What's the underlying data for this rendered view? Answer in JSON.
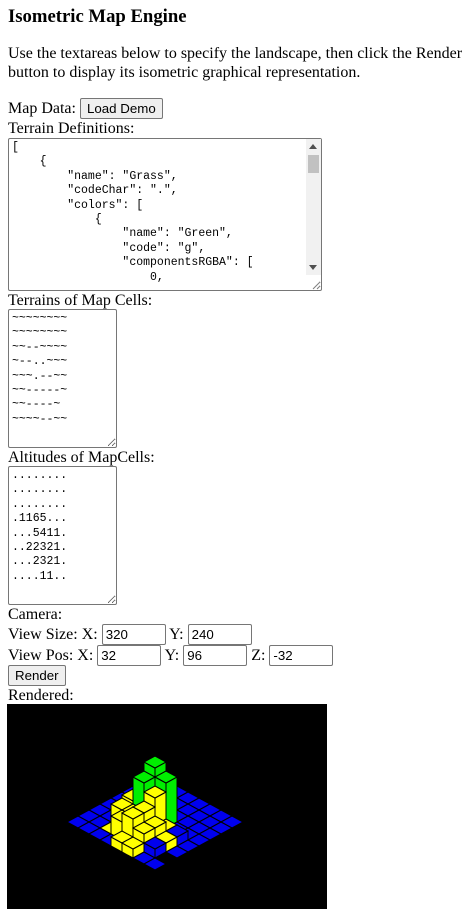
{
  "page": {
    "title": "Isometric Map Engine",
    "intro": "Use the textareas below to specify the landscape, then click the Render button to display its isometric graphical representation."
  },
  "map_data": {
    "label": "Map Data:",
    "load_demo_label": "Load Demo"
  },
  "terrain_definitions": {
    "label": "Terrain Definitions:",
    "value": "[\n    {\n        \"name\": \"Grass\",\n        \"codeChar\": \".\",\n        \"colors\": [\n            {\n                \"name\": \"Green\",\n                \"code\": \"g\",\n                \"componentsRGBA\": [\n                    0,"
  },
  "terrains_of_map_cells": {
    "label": "Terrains of Map Cells:",
    "value": "~~~~~~~~\n~~~~~~~~\n~~--~~~~\n~--..~~~\n~~~.--~~\n~~-----~\n~~----~\n~~~~--~~"
  },
  "altitudes_of_map_cells": {
    "label": "Altitudes of MapCells:",
    "value": "........\n........\n........\n.1165...\n...5411.\n..22321.\n...2321.\n....11.."
  },
  "camera": {
    "label": "Camera:",
    "view_size_label": "View Size: X:",
    "view_size_x": "320",
    "view_size_y_label": "Y:",
    "view_size_y": "240",
    "view_pos_label": "View Pos: X:",
    "view_pos_x": "32",
    "view_pos_y_label": "Y:",
    "view_pos_y": "96",
    "view_pos_z_label": "Z:",
    "view_pos_z": "-32"
  },
  "render": {
    "button_label": "Render",
    "rendered_label": "Rendered:"
  },
  "colors": {
    "water": "#0000ee",
    "grass": "#00ee00",
    "sand": "#ffff00",
    "edge": "#000000",
    "background": "#000000"
  }
}
